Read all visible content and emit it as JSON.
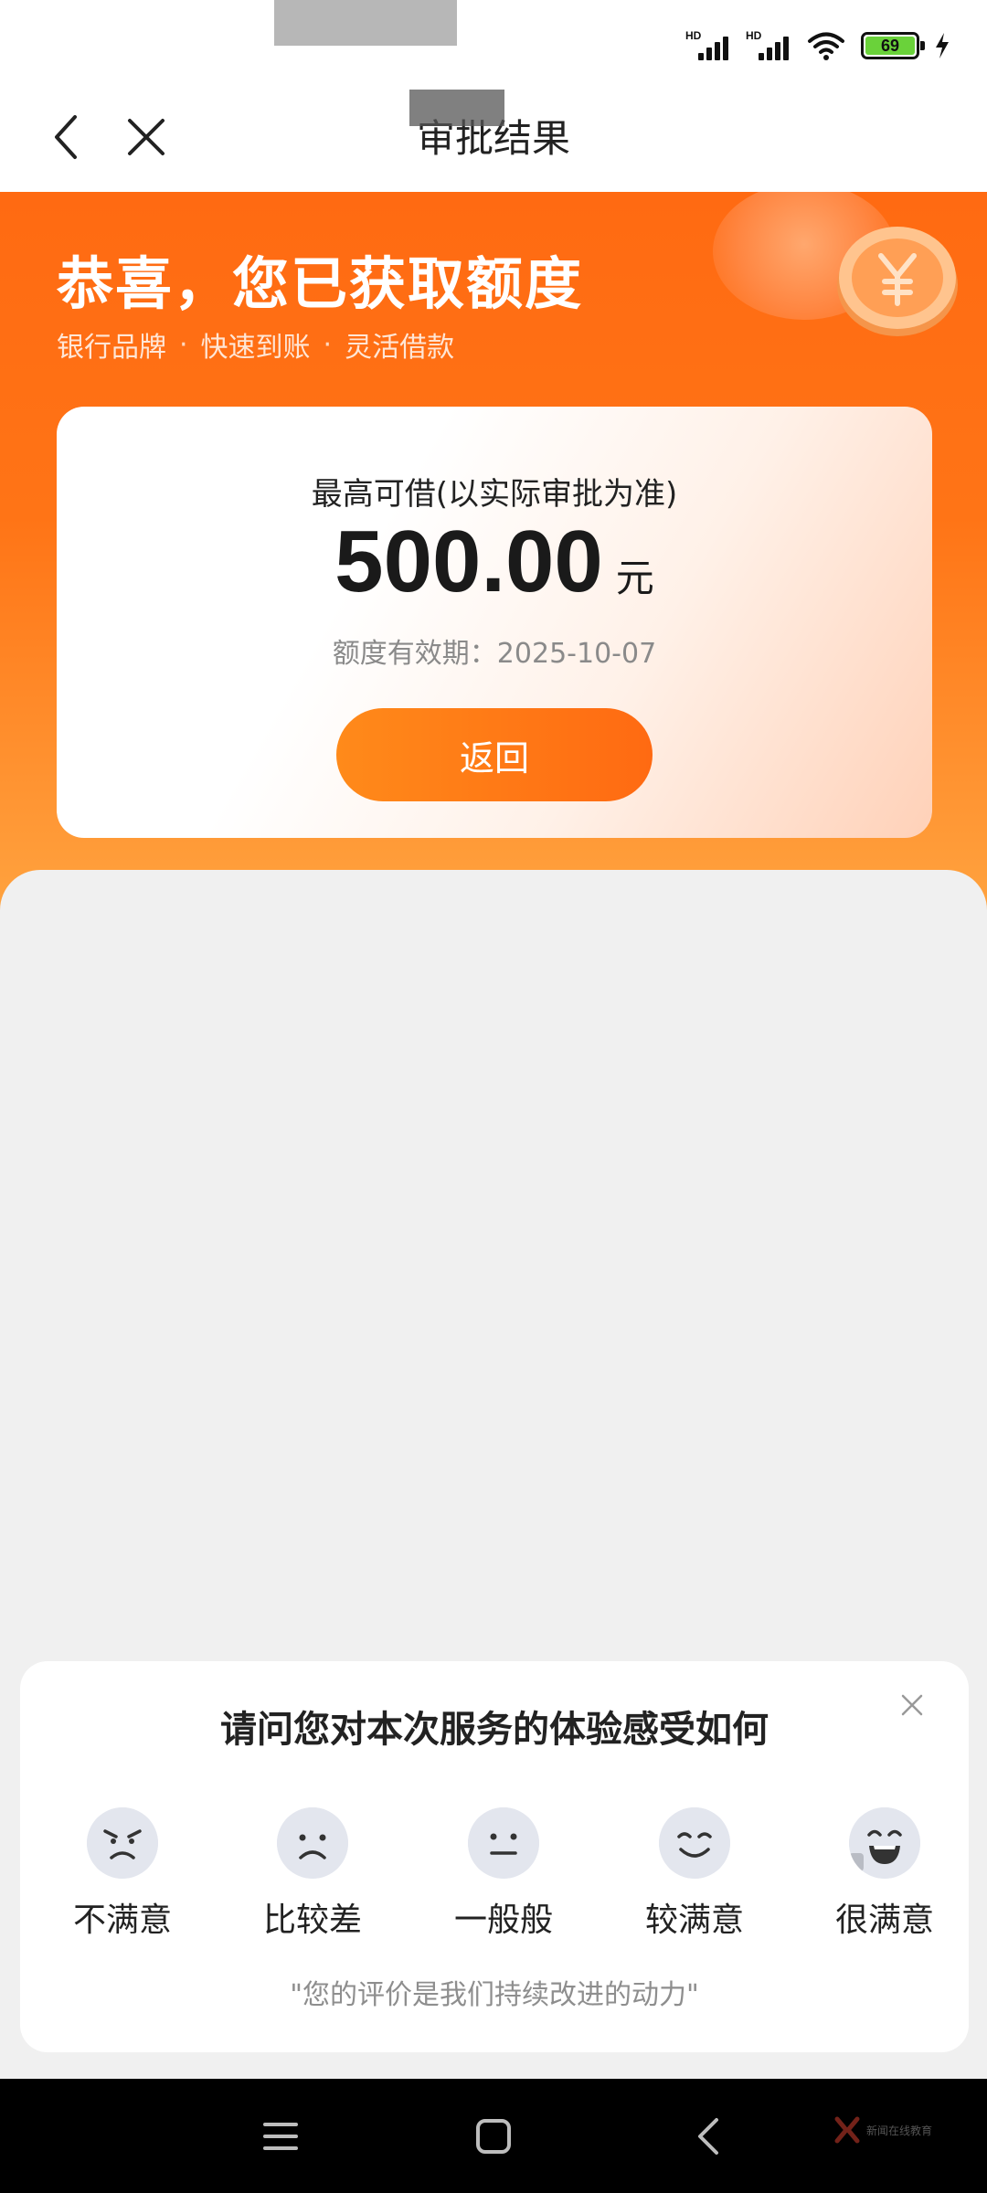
{
  "header": {
    "title": "审批结果"
  },
  "status_bar": {
    "battery_level": "69",
    "signal_1_label": "HD",
    "signal_2_label": "HD"
  },
  "hero": {
    "title": "恭喜，您已获取额度",
    "tags": [
      "银行品牌",
      "快速到账",
      "灵活借款"
    ]
  },
  "amount_card": {
    "label": "最高可借(以实际审批为准)",
    "amount": "500.00",
    "unit": "元",
    "validity": "额度有效期：2025-10-07",
    "return_button": "返回"
  },
  "feedback": {
    "title": "请问您对本次服务的体验感受如何",
    "options": [
      {
        "label": "不满意",
        "icon": "angry-face-icon"
      },
      {
        "label": "比较差",
        "icon": "sad-face-icon"
      },
      {
        "label": "一般般",
        "icon": "neutral-face-icon"
      },
      {
        "label": "较满意",
        "icon": "smile-face-icon"
      },
      {
        "label": "很满意",
        "icon": "laugh-face-icon"
      }
    ],
    "note": "\"您的评价是我们持续改进的动力\""
  },
  "nav": {
    "watermark": "新闻在线教育"
  },
  "colors": {
    "accent_orange": "#ff6a12",
    "hero_bottom": "#ffa33f",
    "face_gray": "#e3e6ee"
  }
}
